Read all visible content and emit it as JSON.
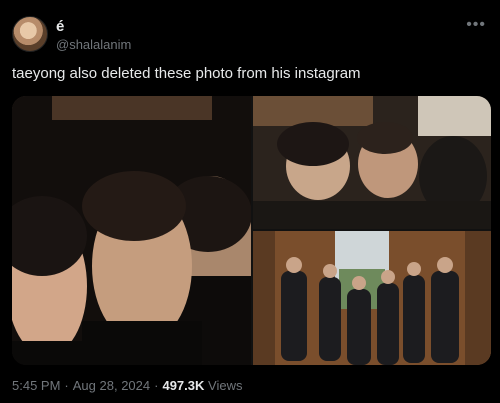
{
  "author": {
    "display_name": "é",
    "handle": "@shalalanim"
  },
  "tweet": {
    "text": "taeyong also deleted these photo from his instagram"
  },
  "meta": {
    "time": "5:45 PM",
    "separator": "·",
    "date": "Aug 28, 2024",
    "views_count": "497.3K",
    "views_label": "Views"
  },
  "icons": {
    "more": "more-icon"
  }
}
